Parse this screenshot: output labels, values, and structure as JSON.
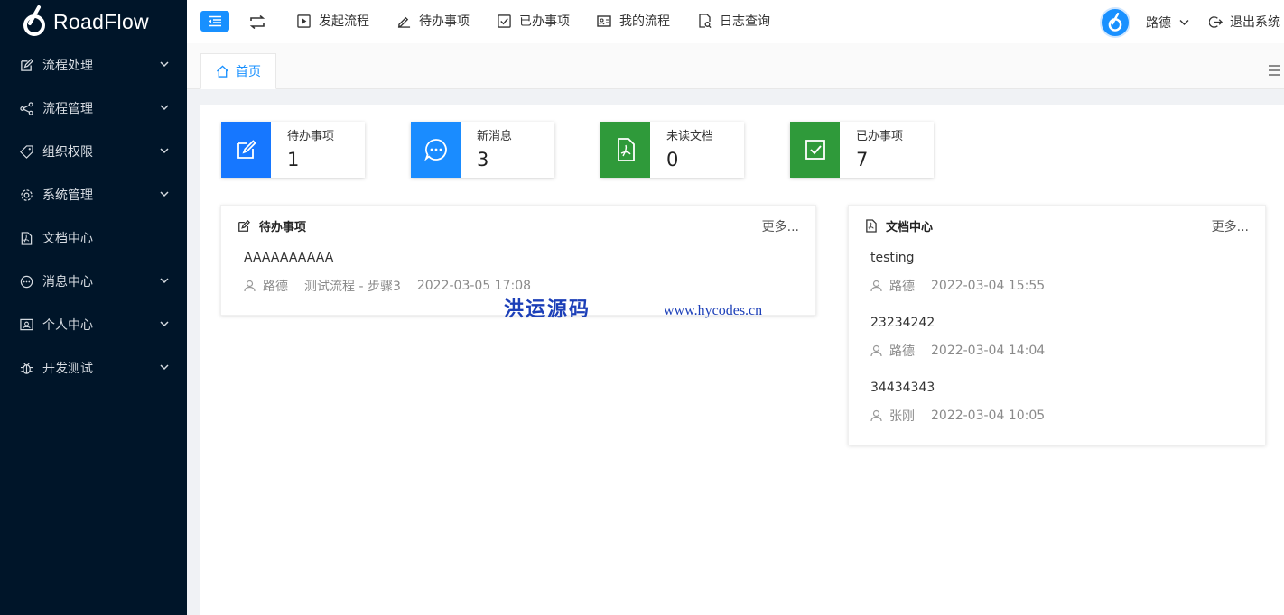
{
  "app": {
    "logo_text": "RoadFlow"
  },
  "sidebar": {
    "items": [
      {
        "label": "流程处理",
        "icon": "edit-icon",
        "has_arrow": true
      },
      {
        "label": "流程管理",
        "icon": "share-icon",
        "has_arrow": true
      },
      {
        "label": "组织权限",
        "icon": "tag-icon",
        "has_arrow": true
      },
      {
        "label": "系统管理",
        "icon": "gear-icon",
        "has_arrow": true
      },
      {
        "label": "文档中心",
        "icon": "pdf-file-icon",
        "has_arrow": false
      },
      {
        "label": "消息中心",
        "icon": "message-icon",
        "has_arrow": true
      },
      {
        "label": "个人中心",
        "icon": "id-card-icon",
        "has_arrow": true
      },
      {
        "label": "开发测试",
        "icon": "bug-icon",
        "has_arrow": true
      }
    ]
  },
  "header": {
    "nav": [
      {
        "label": "发起流程",
        "icon": "play-icon"
      },
      {
        "label": "待办事项",
        "icon": "pencil-icon"
      },
      {
        "label": "已办事项",
        "icon": "checkbox-icon"
      },
      {
        "label": "我的流程",
        "icon": "id-card-icon"
      },
      {
        "label": "日志查询",
        "icon": "file-search-icon"
      }
    ],
    "user_name": "路德",
    "logout_label": "退出系统"
  },
  "tabs": {
    "home_label": "首页"
  },
  "stats": [
    {
      "label": "待办事项",
      "value": "1",
      "color": "#1677ff",
      "icon": "edit-icon"
    },
    {
      "label": "新消息",
      "value": "3",
      "color": "#1a8cff",
      "icon": "message-icon"
    },
    {
      "label": "未读文档",
      "value": "0",
      "color": "#2f9a3a",
      "icon": "pdf-file-icon"
    },
    {
      "label": "已办事项",
      "value": "7",
      "color": "#2f9a3a",
      "icon": "checkbox-icon"
    }
  ],
  "todo_card": {
    "title": "待办事项",
    "more": "更多...",
    "items": [
      {
        "title": "AAAAAAAAAA",
        "user": "路德",
        "flow": "测试流程 - 步骤3",
        "time": "2022-03-05 17:08"
      }
    ]
  },
  "doc_card": {
    "title": "文档中心",
    "more": "更多...",
    "items": [
      {
        "title": "testing",
        "user": "路德",
        "time": "2022-03-04 15:55"
      },
      {
        "title": "23234242",
        "user": "路德",
        "time": "2022-03-04 14:04"
      },
      {
        "title": "34434343",
        "user": "张刚",
        "time": "2022-03-04 10:05"
      }
    ]
  },
  "watermark": {
    "cn": "洪运源码",
    "url": "www.hycodes.cn"
  }
}
